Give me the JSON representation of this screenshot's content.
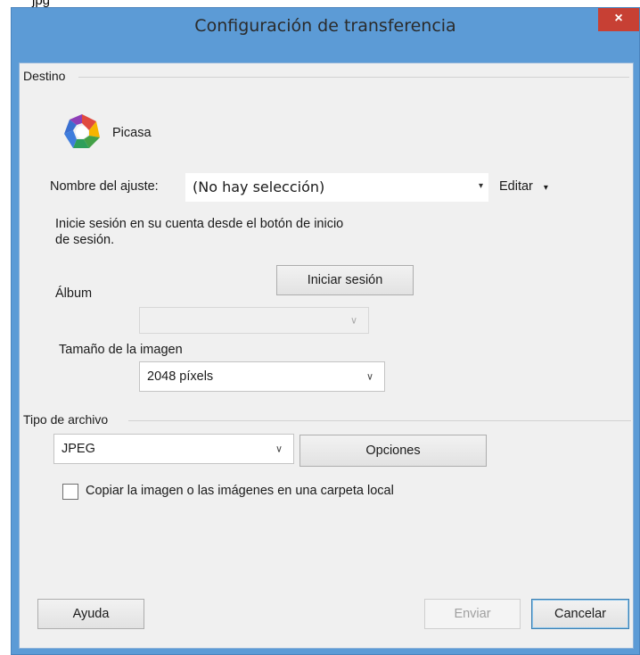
{
  "file_label": "jpg",
  "window": {
    "title": "Configuración de transferencia",
    "close_icon": "×"
  },
  "destination": {
    "group_label": "Destino",
    "service_icon": "picasa-icon",
    "service_name": "Picasa",
    "setting_label": "Nombre del ajuste:",
    "setting_value": "(No hay selección)",
    "setting_arrow": "▾",
    "edit_label": "Editar",
    "edit_arrow": "▾",
    "sign_in_message_line1": "Inicie sesión en su cuenta desde el botón de inicio",
    "sign_in_message_line2": "de sesión.",
    "sign_in_button": "Iniciar sesión",
    "album_label": "Álbum",
    "album_value": "",
    "image_size_label": "Tamaño de la imagen",
    "image_size_value": "2048 píxels"
  },
  "file_type": {
    "group_label": "Tipo de archivo",
    "format_value": "JPEG",
    "options_button": "Opciones",
    "copy_local_checked": false,
    "copy_local_label": "Copiar la imagen o las imágenes en una carpeta local"
  },
  "footer": {
    "help_button": "Ayuda",
    "send_button": "Enviar",
    "cancel_button": "Cancelar"
  },
  "combo_arrow": "∨",
  "colors": {
    "window_frame": "#5c9bd6",
    "close_button": "#c74034",
    "dialog_background": "#f0f0f0"
  }
}
